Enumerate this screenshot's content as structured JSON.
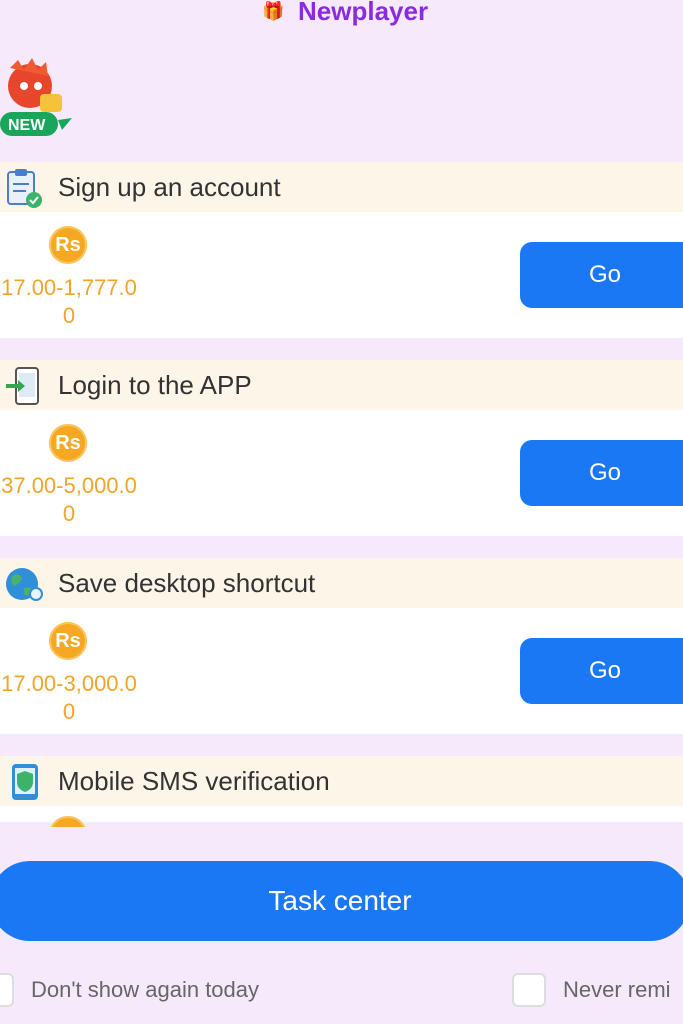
{
  "header": {
    "title": "Newplayer",
    "gift_icon": "gift-icon"
  },
  "badge": {
    "text": "NEW"
  },
  "tasks": [
    {
      "name": "Sign up an account",
      "icon": "clipboard-check-icon",
      "coin": "Rs",
      "reward": "17.00-1,777.00",
      "button": "Go"
    },
    {
      "name": "Login to the APP",
      "icon": "phone-login-icon",
      "coin": "Rs",
      "reward": "37.00-5,000.00",
      "button": "Go"
    },
    {
      "name": "Save desktop shortcut",
      "icon": "globe-icon",
      "coin": "Rs",
      "reward": "17.00-3,000.00",
      "button": "Go"
    },
    {
      "name": "Mobile SMS verification",
      "icon": "shield-phone-icon",
      "coin": "Rs"
    }
  ],
  "footer": {
    "task_center": "Task center",
    "dont_show": "Don't show again today",
    "never_remind": "Never remi"
  },
  "colors": {
    "accent": "#1a78f5",
    "title": "#8a2be2",
    "reward": "#f0a52a",
    "background": "#f5e9fb"
  }
}
